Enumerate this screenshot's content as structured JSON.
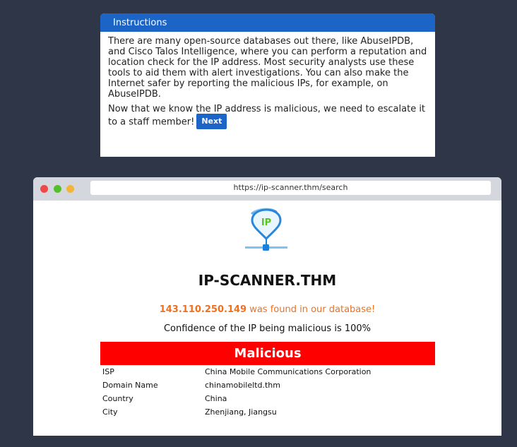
{
  "instructions": {
    "header": "Instructions",
    "paragraph1": "There are many open-source databases out there, like AbuseIPDB, and Cisco Talos Intelligence, where you can perform a reputation and location check for the IP address. Most security analysts use these tools to aid them with alert investigations. You can also make the Internet safer by reporting the malicious IPs, for example, on AbuseIPDB.",
    "paragraph2": "Now that we know the IP address is malicious, we need to escalate it to a staff member!",
    "next_label": "Next"
  },
  "browser": {
    "url": "https://ip-scanner.thm/search",
    "logo_text": "IP",
    "site_title": "IP-SCANNER.THM",
    "ip_address": "143.110.250.149",
    "found_text": " was found in our database!",
    "confidence_text": "Confidence of the IP being malicious is 100%",
    "verdict": "Malicious",
    "details": [
      {
        "key": "ISP",
        "value": "China Mobile Communications Corporation"
      },
      {
        "key": "Domain Name",
        "value": "chinamobileltd.thm"
      },
      {
        "key": "Country",
        "value": "China"
      },
      {
        "key": "City",
        "value": "Zhenjiang, Jiangsu"
      }
    ]
  },
  "colors": {
    "background": "#2f3647",
    "accent": "#1c64c6",
    "malicious": "#ff0000",
    "ip_highlight": "#f0701e"
  }
}
